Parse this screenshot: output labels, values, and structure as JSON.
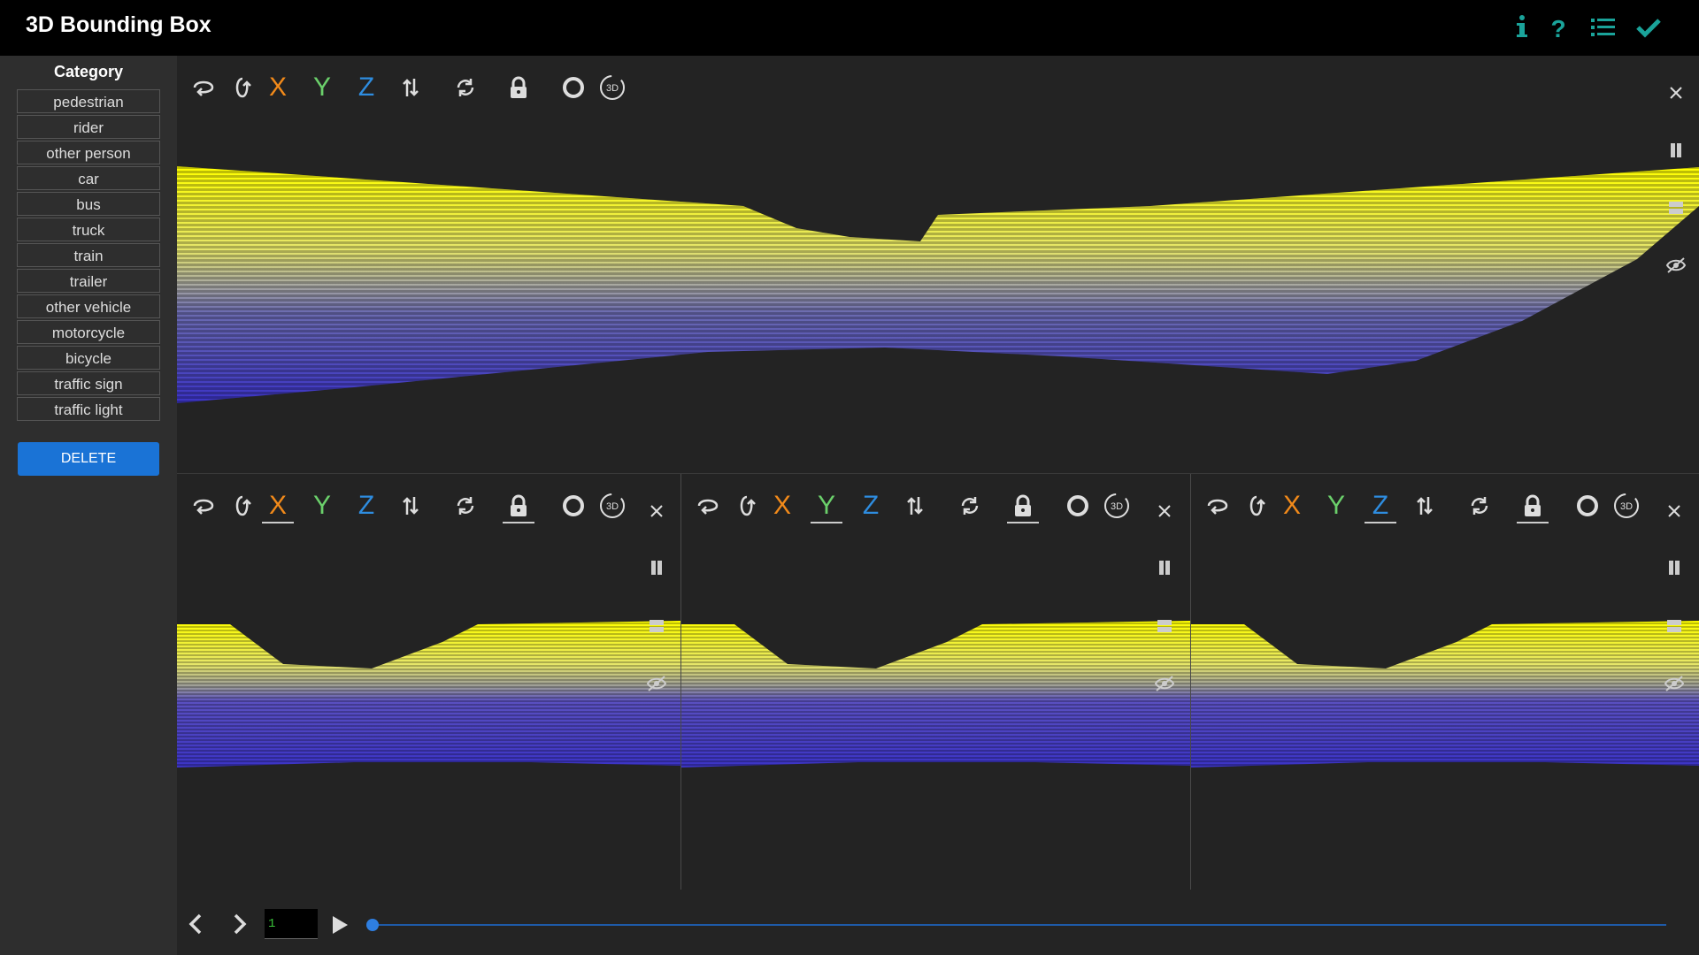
{
  "app": {
    "title": "3D Bounding Box"
  },
  "header_icons": [
    "info-icon",
    "help-icon",
    "list-icon",
    "check-icon"
  ],
  "sidebar": {
    "heading": "Category",
    "categories": [
      "pedestrian",
      "rider",
      "other person",
      "car",
      "bus",
      "truck",
      "train",
      "trailer",
      "other vehicle",
      "motorcycle",
      "bicycle",
      "traffic sign",
      "traffic light"
    ],
    "delete_label": "DELETE"
  },
  "views": {
    "main": {
      "axes": {
        "x": "X",
        "y": "Y",
        "z": "Z"
      },
      "cube_label": "3D"
    },
    "x_view": {
      "axes": {
        "x": "X",
        "y": "Y",
        "z": "Z"
      },
      "cube_label": "3D",
      "active_axis": "X"
    },
    "y_view": {
      "axes": {
        "x": "X",
        "y": "Y",
        "z": "Z"
      },
      "cube_label": "3D",
      "active_axis": "Y"
    },
    "z_view": {
      "axes": {
        "x": "X",
        "y": "Y",
        "z": "Z"
      },
      "cube_label": "3D",
      "active_axis": "Z"
    }
  },
  "playback": {
    "frame": "1",
    "progress": 0.0
  },
  "colors": {
    "accent_teal": "#1aa39a",
    "delete": "#1a73d6",
    "x": "#f28a1a",
    "y": "#6bd06b",
    "z": "#2e8de0",
    "point_high": "#ffff00",
    "point_low": "#3b33c4"
  }
}
